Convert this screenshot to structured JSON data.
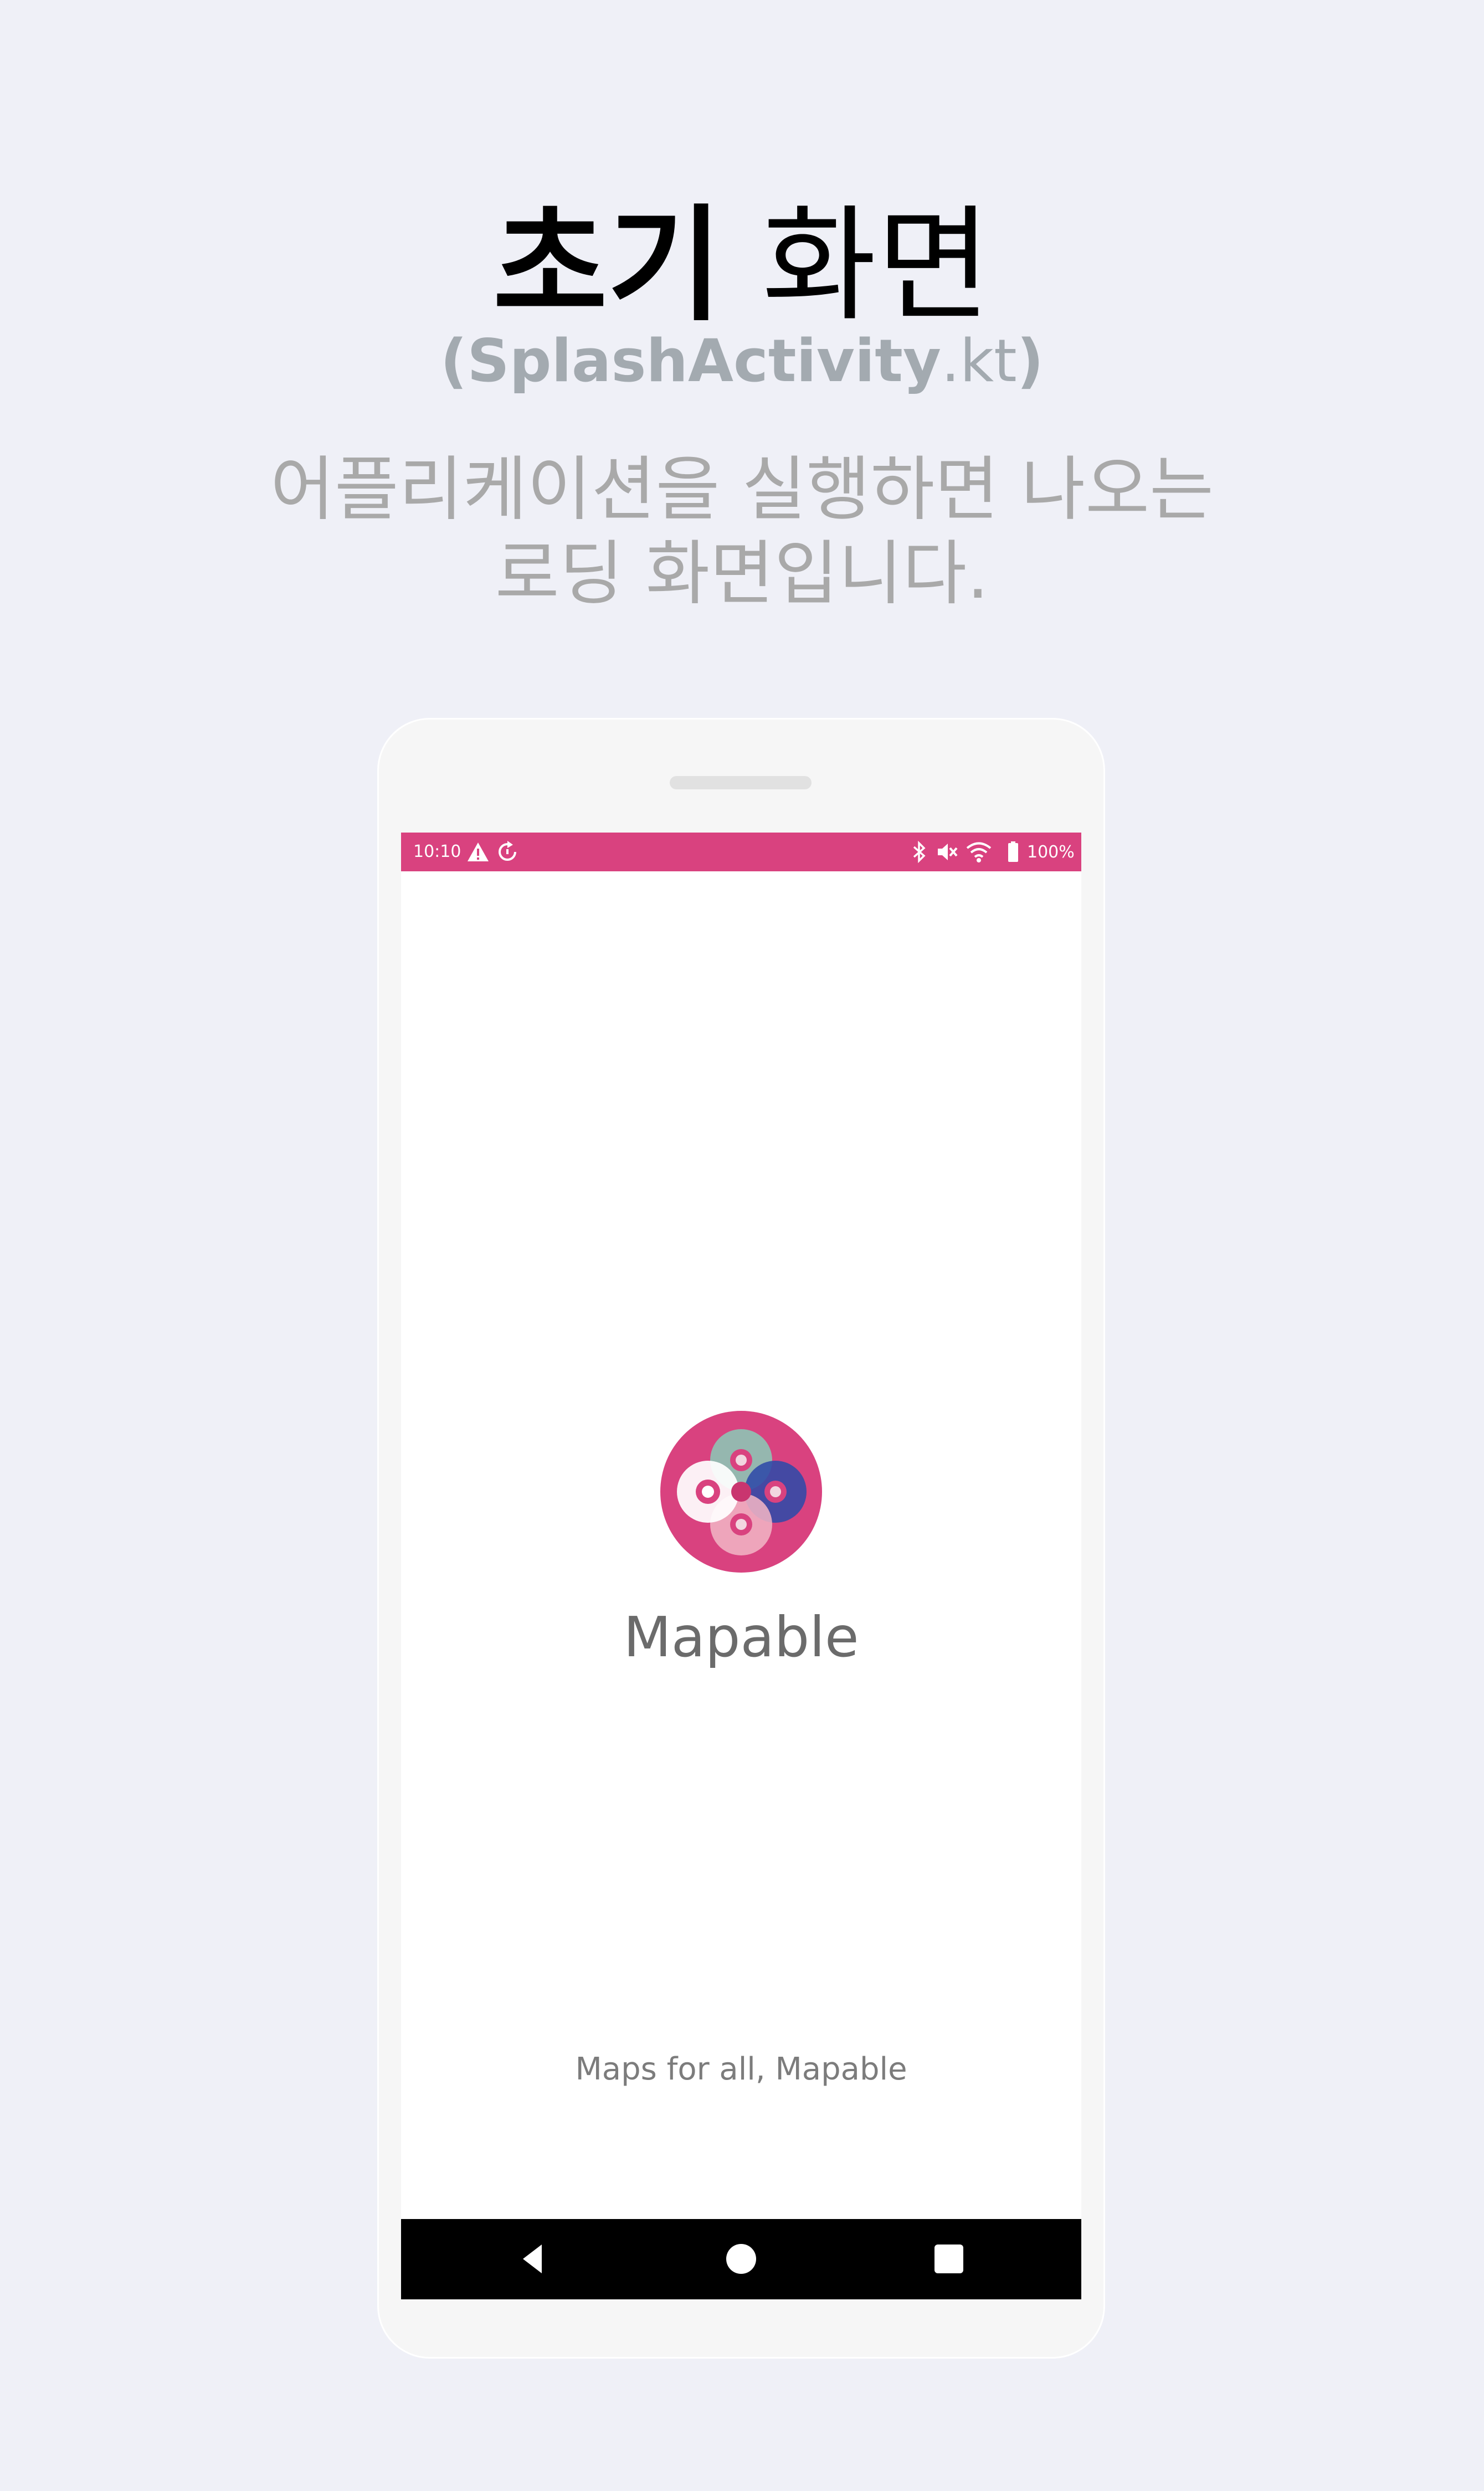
{
  "header": {
    "title_bold": "초기",
    "title_light": "화면",
    "subtitle_paren_open": "(",
    "subtitle_bold": "SplashActivity",
    "subtitle_light": ".kt",
    "subtitle_paren_close": ")",
    "description_line1": "어플리케이션을 실행하면 나오는",
    "description_line2": "로딩 화면입니다."
  },
  "phone": {
    "status_bar": {
      "time": "10:10",
      "battery": "100%",
      "color": "#d9427f",
      "left_icons": [
        "warning-icon",
        "sync-icon"
      ],
      "right_icons": [
        "bluetooth-icon",
        "mute-icon",
        "wifi-icon",
        "battery-icon"
      ]
    },
    "splash": {
      "app_name": "Mapable",
      "tagline": "Maps for all, Mapable",
      "logo_icon": "mapable-logo"
    },
    "nav_bar": {
      "buttons": [
        "back-icon",
        "home-icon",
        "recents-icon"
      ]
    }
  }
}
